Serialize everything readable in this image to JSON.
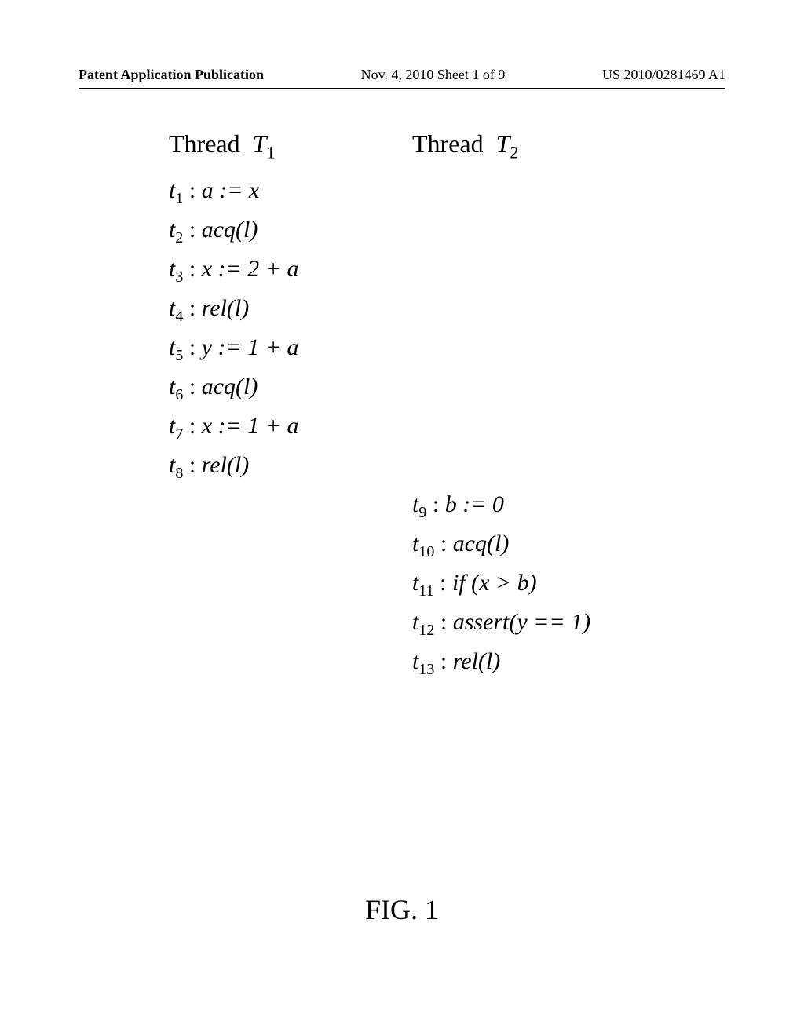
{
  "header": {
    "publication_label": "Patent Application Publication",
    "date_and_sheet": "Nov. 4, 2010  Sheet 1 of 9",
    "pub_number": "US 2010/0281469 A1"
  },
  "threads": {
    "t1_label": "Thread",
    "t1_var": "T",
    "t1_sub": "1",
    "t2_label": "Thread",
    "t2_var": "T",
    "t2_sub": "2"
  },
  "steps": {
    "t1": {
      "label": "t",
      "sub": "1",
      "sep": " : ",
      "body": "a := x"
    },
    "t2": {
      "label": "t",
      "sub": "2",
      "sep": " : ",
      "body_pre": "acq",
      "body_args": "(l)"
    },
    "t3": {
      "label": "t",
      "sub": "3",
      "sep": " : ",
      "body": "x := 2 + a"
    },
    "t4": {
      "label": "t",
      "sub": "4",
      "sep": " : ",
      "body_pre": "rel",
      "body_args": "(l)"
    },
    "t5": {
      "label": "t",
      "sub": "5",
      "sep": " : ",
      "body": "y := 1 + a"
    },
    "t6": {
      "label": "t",
      "sub": "6",
      "sep": " : ",
      "body_pre": "acq",
      "body_args": "(l)"
    },
    "t7": {
      "label": "t",
      "sub": "7",
      "sep": " : ",
      "body": "x := 1 + a"
    },
    "t8": {
      "label": "t",
      "sub": "8",
      "sep": " : ",
      "body_pre": "rel",
      "body_args": "(l)"
    },
    "t9": {
      "label": "t",
      "sub": "9",
      "sep": " : ",
      "body": "b := 0"
    },
    "t10": {
      "label": "t",
      "sub": "10",
      "sep": " : ",
      "body_pre": "acq",
      "body_args": "(l)"
    },
    "t11": {
      "label": "t",
      "sub": "11",
      "sep": " : ",
      "body_pre": "if ",
      "body_args": "(x > b)"
    },
    "t12": {
      "label": "t",
      "sub": "12",
      "sep": " : ",
      "body_pre": "assert",
      "body_args": "(y == 1)"
    },
    "t13": {
      "label": "t",
      "sub": "13",
      "sep": " : ",
      "body_pre": "rel",
      "body_args": "(l)"
    }
  },
  "figure_label": "FIG. 1"
}
